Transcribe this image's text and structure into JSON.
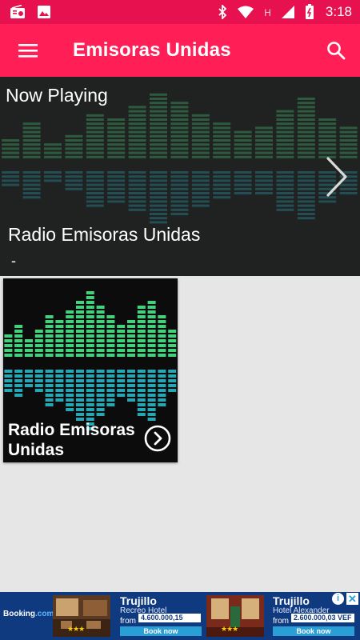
{
  "status_bar": {
    "time": "3:18",
    "icons": [
      "radio-icon",
      "image-icon",
      "bluetooth-icon",
      "wifi-icon",
      "network-h-icon",
      "signal-icon",
      "battery-icon"
    ],
    "network_label": "H"
  },
  "toolbar": {
    "title": "Emisoras Unidas",
    "menu_icon": "menu-icon",
    "search_icon": "search-icon"
  },
  "now_playing": {
    "label": "Now Playing",
    "station": "Radio Emisoras Unidas",
    "subtitle": "-"
  },
  "stations": [
    {
      "name": "Radio Emisoras Unidas"
    }
  ],
  "ad": {
    "logo_main": "Booking",
    "logo_suffix": ".com",
    "hotels": [
      {
        "city": "Trujillo",
        "name": "Recreo Hotel",
        "from": "from",
        "price": "4.600.000,15 VEF",
        "cta": "Book now",
        "stars": "★★★"
      },
      {
        "city": "Trujillo",
        "name": "Hotel Alexander",
        "from": "from",
        "price": "2.600.000,03 VEF",
        "cta": "Book now",
        "stars": "★★★"
      }
    ]
  },
  "colors": {
    "status_bar": "#e8114f",
    "toolbar": "#ff1f56",
    "background": "#e6e6e6",
    "eq_green": "#43d17e",
    "eq_teal": "#2ab7c6",
    "ad_blue": "#0f3a80"
  }
}
